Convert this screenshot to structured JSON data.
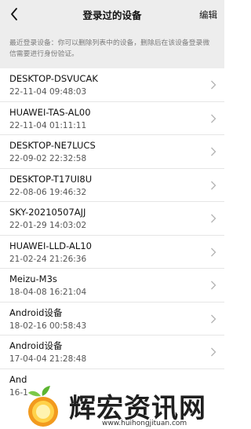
{
  "header": {
    "title": "登录过的设备",
    "edit_label": "编辑"
  },
  "notice": "最近登录设备：你可以删除列表中的设备，删除后在该设备登录微信需要进行身份验证。",
  "devices": [
    {
      "name": "DESKTOP-DSVUCAK",
      "time": "22-11-04 09:48:03"
    },
    {
      "name": "HUAWEI-TAS-AL00",
      "time": "22-11-04 01:11:11"
    },
    {
      "name": "DESKTOP-NE7LUCS",
      "time": "22-09-02 22:32:58"
    },
    {
      "name": "DESKTOP-T17UI8U",
      "time": "22-08-06 19:46:32"
    },
    {
      "name": "SKY-20210507AJJ",
      "time": "22-01-29 14:03:02"
    },
    {
      "name": "HUAWEI-LLD-AL10",
      "time": "21-02-24 21:26:36"
    },
    {
      "name": "Meizu-M3s",
      "time": "18-04-08 16:21:04"
    },
    {
      "name": "Android设备",
      "time": "18-02-16 00:58:43"
    },
    {
      "name": "Android设备",
      "time": "17-04-04 21:28:48"
    },
    {
      "name": "And",
      "time": "16-1"
    }
  ],
  "watermark": {
    "text": "辉宏资讯网",
    "url": "www.huihongjituan.com"
  }
}
